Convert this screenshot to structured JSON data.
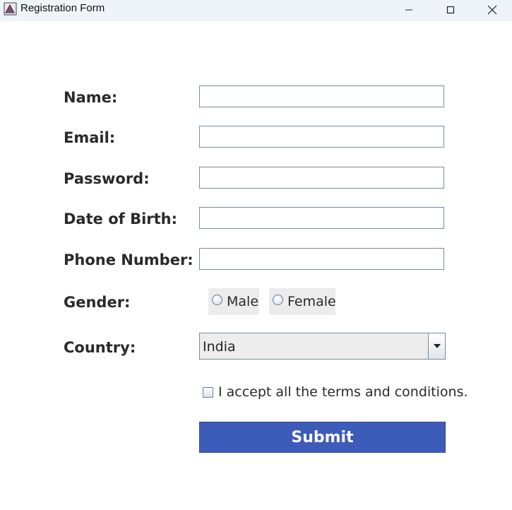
{
  "window": {
    "title": "Registration Form",
    "icon": "java-app-icon",
    "controls": [
      "minimize-icon",
      "maximize-icon",
      "close-icon"
    ]
  },
  "form": {
    "fields": [
      {
        "label": "Name:",
        "value": ""
      },
      {
        "label": "Email:",
        "value": ""
      },
      {
        "label": "Password:",
        "value": ""
      },
      {
        "label": "Date of Birth:",
        "value": ""
      },
      {
        "label": "Phone Number:",
        "value": ""
      }
    ],
    "gender": {
      "label": "Gender:",
      "options": [
        "Male",
        "Female"
      ],
      "selected": null
    },
    "country": {
      "label": "Country:",
      "selected": "India"
    },
    "terms": {
      "label": "I accept all the terms and conditions.",
      "checked": false
    },
    "submit_label": "Submit"
  },
  "colors": {
    "titlebar": "#eef4f9",
    "submit_bg": "#3d5bb8",
    "input_border": "#7a8a9e"
  }
}
